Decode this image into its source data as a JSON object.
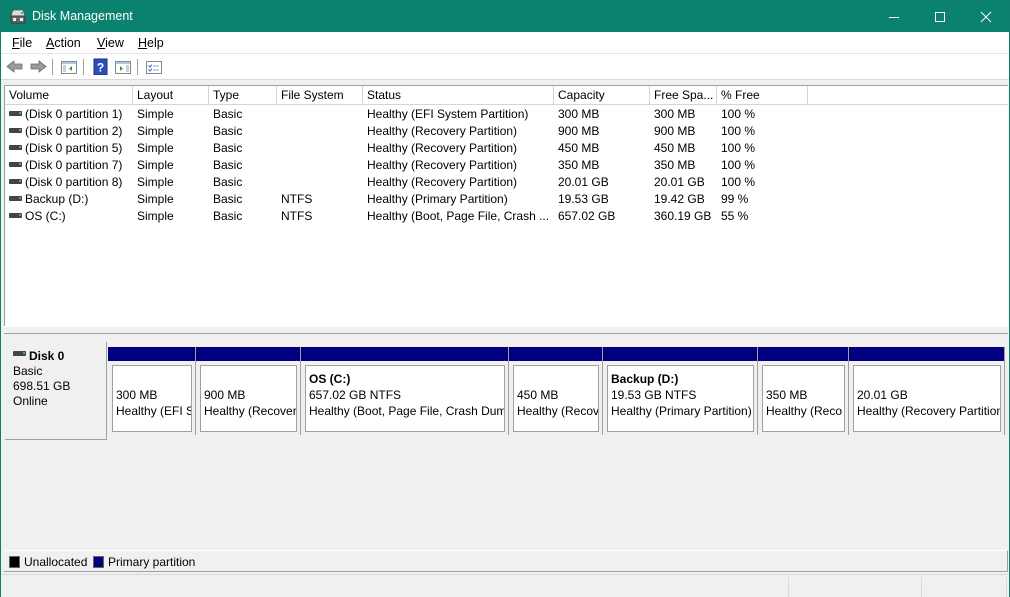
{
  "window": {
    "title": "Disk Management",
    "icon": "disk-management-icon",
    "controls": {
      "minimize": "minimize-icon",
      "maximize": "maximize-icon",
      "close": "close-icon"
    }
  },
  "menu": [
    {
      "label": "File",
      "accel": "F",
      "rest": "ile"
    },
    {
      "label": "Action",
      "accel": "A",
      "rest": "ction"
    },
    {
      "label": "View",
      "accel": "V",
      "rest": "iew"
    },
    {
      "label": "Help",
      "accel": "H",
      "rest": "elp"
    }
  ],
  "toolbar": [
    {
      "name": "back-button",
      "icon": "back-arrow-icon"
    },
    {
      "name": "forward-button",
      "icon": "forward-arrow-icon"
    },
    {
      "name": "show-hide-console-tree-button",
      "icon": "console-tree-icon"
    },
    {
      "name": "help-button",
      "icon": "help-icon"
    },
    {
      "name": "show-hide-action-pane-button",
      "icon": "action-pane-icon"
    },
    {
      "name": "properties-button",
      "icon": "properties-icon"
    }
  ],
  "volume_list": {
    "columns": [
      "Volume",
      "Layout",
      "Type",
      "File System",
      "Status",
      "Capacity",
      "Free Spa...",
      "% Free"
    ],
    "rows": [
      {
        "volume": "(Disk 0 partition 1)",
        "layout": "Simple",
        "type": "Basic",
        "fs": "",
        "status": "Healthy (EFI System Partition)",
        "capacity": "300 MB",
        "free": "300 MB",
        "pct": "100 %"
      },
      {
        "volume": "(Disk 0 partition 2)",
        "layout": "Simple",
        "type": "Basic",
        "fs": "",
        "status": "Healthy (Recovery Partition)",
        "capacity": "900 MB",
        "free": "900 MB",
        "pct": "100 %"
      },
      {
        "volume": "(Disk 0 partition 5)",
        "layout": "Simple",
        "type": "Basic",
        "fs": "",
        "status": "Healthy (Recovery Partition)",
        "capacity": "450 MB",
        "free": "450 MB",
        "pct": "100 %"
      },
      {
        "volume": "(Disk 0 partition 7)",
        "layout": "Simple",
        "type": "Basic",
        "fs": "",
        "status": "Healthy (Recovery Partition)",
        "capacity": "350 MB",
        "free": "350 MB",
        "pct": "100 %"
      },
      {
        "volume": "(Disk 0 partition 8)",
        "layout": "Simple",
        "type": "Basic",
        "fs": "",
        "status": "Healthy (Recovery Partition)",
        "capacity": "20.01 GB",
        "free": "20.01 GB",
        "pct": "100 %"
      },
      {
        "volume": "Backup (D:)",
        "layout": "Simple",
        "type": "Basic",
        "fs": "NTFS",
        "status": "Healthy (Primary Partition)",
        "capacity": "19.53 GB",
        "free": "19.42 GB",
        "pct": "99 %"
      },
      {
        "volume": "OS (C:)",
        "layout": "Simple",
        "type": "Basic",
        "fs": "NTFS",
        "status": "Healthy (Boot, Page File, Crash ...",
        "capacity": "657.02 GB",
        "free": "360.19 GB",
        "pct": "55 %"
      }
    ]
  },
  "disk": {
    "name": "Disk 0",
    "type": "Basic",
    "size": "698.51 GB",
    "state": "Online",
    "partitions": [
      {
        "name": "",
        "size": "300 MB",
        "status": "Healthy (EFI S"
      },
      {
        "name": "",
        "size": "900 MB",
        "status": "Healthy (Recover"
      },
      {
        "name": "OS  (C:)",
        "size": "657.02 GB NTFS",
        "status": "Healthy (Boot, Page File, Crash Dum"
      },
      {
        "name": "",
        "size": "450 MB",
        "status": "Healthy (Recov"
      },
      {
        "name": "Backup  (D:)",
        "size": "19.53 GB NTFS",
        "status": "Healthy (Primary Partition)"
      },
      {
        "name": "",
        "size": "350 MB",
        "status": "Healthy (Reco"
      },
      {
        "name": "",
        "size": "20.01 GB",
        "status": "Healthy (Recovery Partition"
      }
    ]
  },
  "legend": [
    {
      "label": "Unallocated",
      "color": "#000000"
    },
    {
      "label": "Primary partition",
      "color": "#000080"
    }
  ],
  "colors": {
    "titlebar": "#0b8170",
    "primary_partition": "#000080"
  }
}
